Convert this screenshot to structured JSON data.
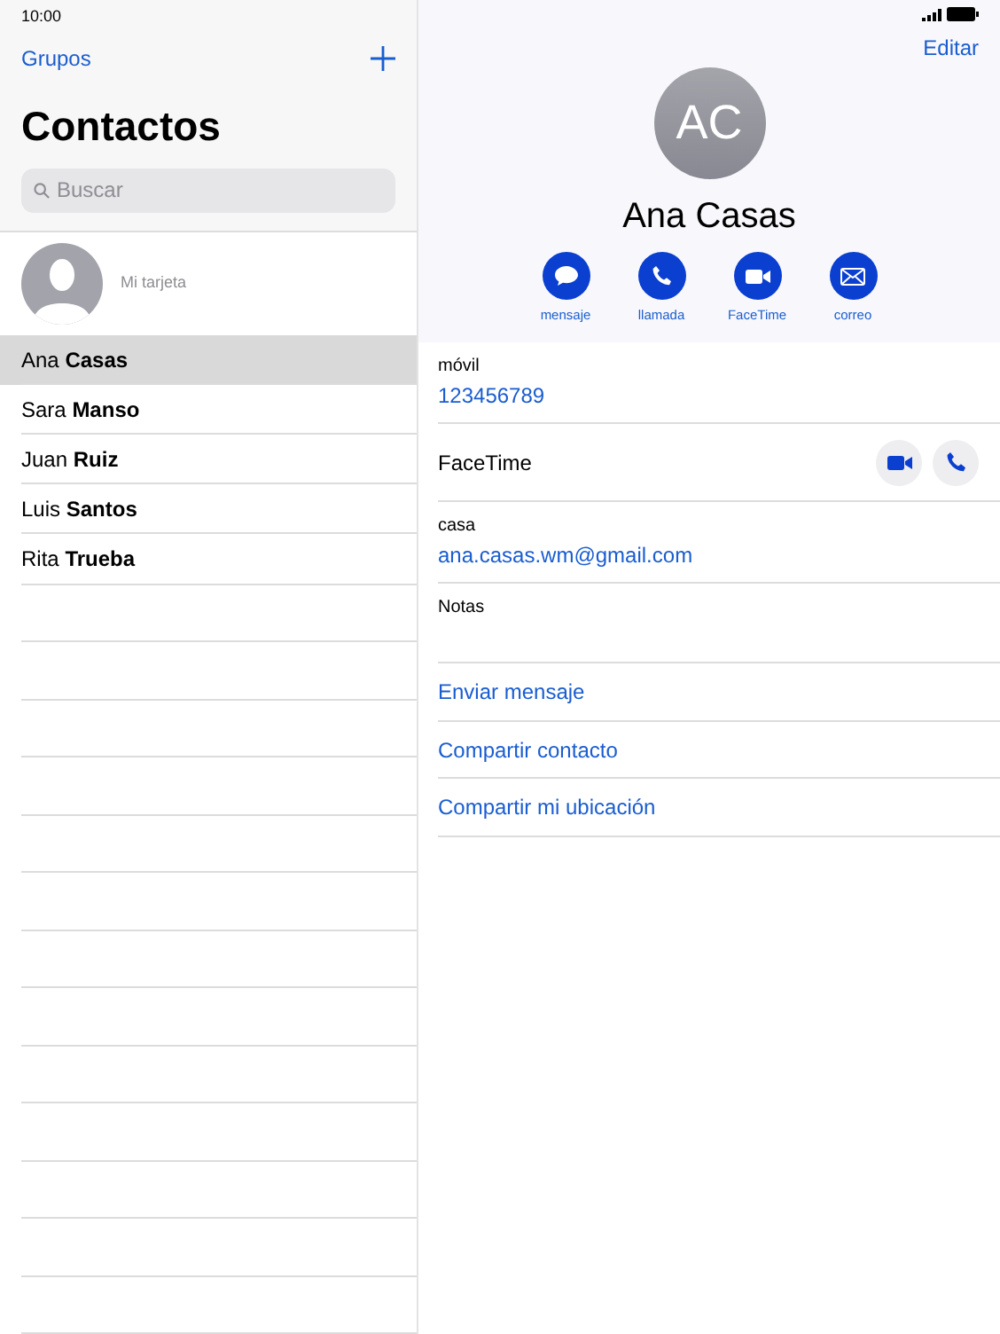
{
  "status_bar": {
    "time": "10:00"
  },
  "sidebar": {
    "groups_link": "Grupos",
    "title": "Contactos",
    "search": {
      "placeholder": "Buscar"
    },
    "my_card": "Mi tarjeta",
    "contacts": [
      {
        "name": "Ana **Casas**",
        "selected": true
      },
      {
        "name": "Sara **Manso**",
        "selected": false
      },
      {
        "name": "Juan **Ruiz**",
        "selected": false
      },
      {
        "name": "Luis **Santos**",
        "selected": false
      },
      {
        "name": "Rita **Trueba**",
        "selected": false
      }
    ]
  },
  "detail": {
    "edit_link": "Editar",
    "initials": "AC",
    "name": "Ana Casas",
    "actions": [
      {
        "kind": "message",
        "label": "mensaje"
      },
      {
        "kind": "call",
        "label": "llamada"
      },
      {
        "kind": "video",
        "label": "FaceTime"
      },
      {
        "kind": "mail",
        "label": "correo"
      }
    ],
    "fields": [
      {
        "kind": "value",
        "label": "móvil",
        "value": "123456789"
      },
      {
        "kind": "facetime",
        "label": "FaceTime"
      },
      {
        "kind": "value",
        "label": "casa",
        "value": "ana.casas.wm@gmail.com"
      },
      {
        "kind": "notes",
        "label": "Notas"
      }
    ],
    "links": [
      "Enviar mensaje",
      "Compartir contacto",
      "Compartir mi ubicación"
    ]
  }
}
